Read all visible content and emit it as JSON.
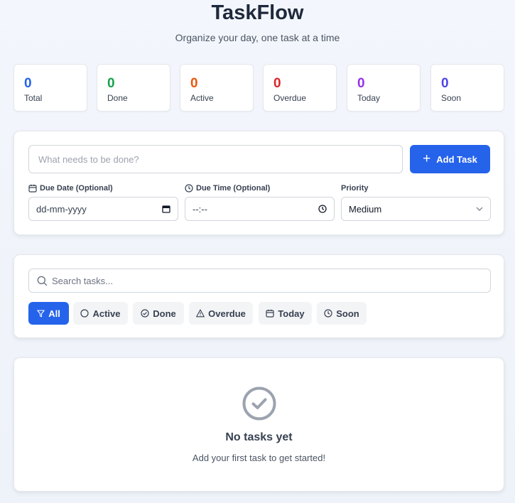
{
  "header": {
    "title": "TaskFlow",
    "subtitle": "Organize your day, one task at a time"
  },
  "stats": [
    {
      "value": "0",
      "label": "Total",
      "color": "#2563eb"
    },
    {
      "value": "0",
      "label": "Done",
      "color": "#16a34a"
    },
    {
      "value": "0",
      "label": "Active",
      "color": "#ea580c"
    },
    {
      "value": "0",
      "label": "Overdue",
      "color": "#dc2626"
    },
    {
      "value": "0",
      "label": "Today",
      "color": "#9333ea"
    },
    {
      "value": "0",
      "label": "Soon",
      "color": "#4f46e5"
    }
  ],
  "add_form": {
    "task_placeholder": "What needs to be done?",
    "add_button_label": "Add Task",
    "due_date_label": "Due Date (Optional)",
    "due_date_placeholder": "dd-mm-yyyy",
    "due_time_label": "Due Time (Optional)",
    "due_time_placeholder": "--:--",
    "priority_label": "Priority",
    "priority_value": "Medium"
  },
  "filter": {
    "search_placeholder": "Search tasks...",
    "chips": [
      {
        "label": "All",
        "icon": "funnel-icon",
        "active": true
      },
      {
        "label": "Active",
        "icon": "circle-icon",
        "active": false
      },
      {
        "label": "Done",
        "icon": "check-circle-icon",
        "active": false
      },
      {
        "label": "Overdue",
        "icon": "warning-triangle-icon",
        "active": false
      },
      {
        "label": "Today",
        "icon": "calendar-icon",
        "active": false
      },
      {
        "label": "Soon",
        "icon": "clock-icon",
        "active": false
      }
    ]
  },
  "empty_state": {
    "icon": "check-circle-icon",
    "title": "No tasks yet",
    "message": "Add your first task to get started!"
  },
  "colors": {
    "accent": "#2563eb",
    "muted_icon": "#9ca3af"
  }
}
